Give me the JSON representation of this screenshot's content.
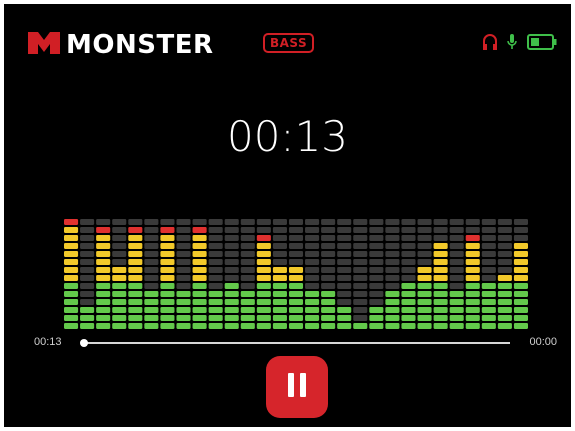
{
  "header": {
    "brand": "MONSTER",
    "badge": "BASS",
    "status_icons": [
      {
        "name": "headphones-icon",
        "color": "#d11f25"
      },
      {
        "name": "microphone-icon",
        "color": "#3fbf4a"
      },
      {
        "name": "battery-icon",
        "color": "#3fbf4a"
      }
    ]
  },
  "player": {
    "timer": "00:13",
    "elapsed": "00:13",
    "remaining": "00:00",
    "progress": 0.0,
    "state": "playing",
    "pause_icon": "pause-icon"
  },
  "equalizer": {
    "rows": 14,
    "columns": 29,
    "levels": [
      14,
      3,
      13,
      8,
      13,
      5,
      13,
      5,
      13,
      5,
      6,
      5,
      12,
      8,
      8,
      5,
      5,
      3,
      1,
      3,
      5,
      6,
      8,
      11,
      5,
      12,
      6,
      7,
      11
    ],
    "colors": {
      "off": "#3a3a3a",
      "green": "#63c94b",
      "yellow": "#f2c92a",
      "red": "#e0312f"
    }
  },
  "colors": {
    "accent": "#d6252b",
    "background": "#000000"
  }
}
